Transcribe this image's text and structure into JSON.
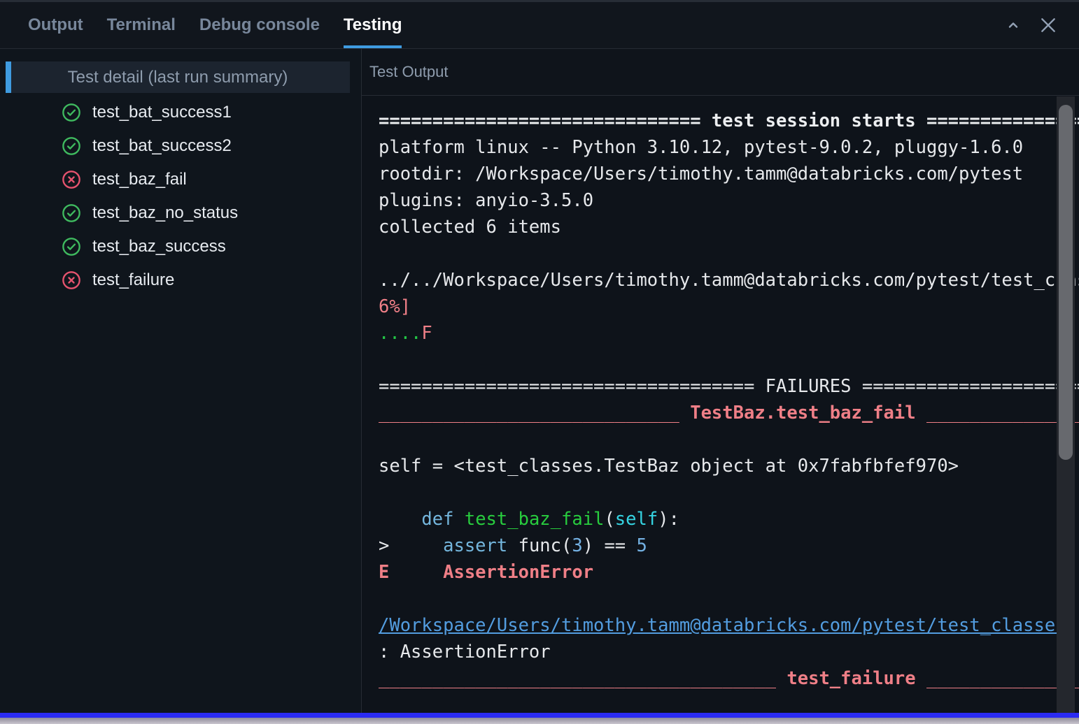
{
  "tabs": {
    "items": [
      {
        "label": "Output",
        "active": false
      },
      {
        "label": "Terminal",
        "active": false
      },
      {
        "label": "Debug console",
        "active": false
      },
      {
        "label": "Testing",
        "active": true
      }
    ]
  },
  "window_controls": {
    "collapse_icon": "chevron-up-icon",
    "close_icon": "close-icon"
  },
  "sidebar": {
    "header": "Test detail (last run summary)",
    "status_icons": {
      "pass": "check-circle-icon",
      "fail": "x-circle-icon"
    },
    "tests": [
      {
        "name": "test_bat_success1",
        "status": "pass"
      },
      {
        "name": "test_bat_success2",
        "status": "pass"
      },
      {
        "name": "test_baz_fail",
        "status": "fail"
      },
      {
        "name": "test_baz_no_status",
        "status": "pass"
      },
      {
        "name": "test_baz_success",
        "status": "pass"
      },
      {
        "name": "test_failure",
        "status": "fail"
      }
    ]
  },
  "output_panel": {
    "header": "Test Output",
    "lines": [
      [
        {
          "t": "============================== test session starts ==================================",
          "c": "wb"
        }
      ],
      [
        {
          "t": "platform linux -- Python 3.10.12, pytest-9.0.2, pluggy-1.6.0",
          "c": "w"
        }
      ],
      [
        {
          "t": "rootdir: /Workspace/Users/timothy.tamm@databricks.com/pytest",
          "c": "w"
        }
      ],
      [
        {
          "t": "plugins: anyio-3.5.0",
          "c": "w"
        }
      ],
      [
        {
          "t": "collected 6 items",
          "c": "w"
        }
      ],
      [],
      [
        {
          "t": "../../Workspace/Users/timothy.tamm@databricks.com/pytest/test_classes.py",
          "c": "w"
        }
      ],
      [
        {
          "t": "6%]",
          "c": "sal"
        }
      ],
      [
        {
          "t": "....",
          "c": "grn"
        },
        {
          "t": "F",
          "c": "sal"
        }
      ],
      [],
      [
        {
          "t": "=================================== FAILURES ===================================",
          "c": "w"
        }
      ],
      [
        {
          "t": "____________________________ ",
          "c": "sal"
        },
        {
          "t": "TestBaz.test_baz_fail",
          "c": "salb"
        },
        {
          "t": " ______________________________________",
          "c": "sal"
        }
      ],
      [],
      [
        {
          "t": "self = <test_classes.TestBaz object at 0x7fabfbfef970>",
          "c": "w"
        }
      ],
      [],
      [
        {
          "t": "    ",
          "c": "w"
        },
        {
          "t": "def",
          "c": "kw"
        },
        {
          "t": " ",
          "c": "w"
        },
        {
          "t": "test_baz_fail",
          "c": "fn"
        },
        {
          "t": "(",
          "c": "w"
        },
        {
          "t": "self",
          "c": "slf"
        },
        {
          "t": "):",
          "c": "w"
        }
      ],
      [
        {
          "t": ">     ",
          "c": "w"
        },
        {
          "t": "assert",
          "c": "kw"
        },
        {
          "t": " func(",
          "c": "w"
        },
        {
          "t": "3",
          "c": "num"
        },
        {
          "t": ") == ",
          "c": "w"
        },
        {
          "t": "5",
          "c": "num"
        }
      ],
      [
        {
          "t": "E",
          "c": "salb"
        },
        {
          "t": "     ",
          "c": "w"
        },
        {
          "t": "AssertionError",
          "c": "salb"
        }
      ],
      [],
      [
        {
          "t": "/Workspace/Users/timothy.tamm@databricks.com/pytest/test_classes",
          "c": "lnk"
        }
      ],
      [
        {
          "t": ": AssertionError",
          "c": "w"
        }
      ],
      [
        {
          "t": "_____________________________________ ",
          "c": "sal"
        },
        {
          "t": "test_failure",
          "c": "salb"
        },
        {
          "t": " ______________________________",
          "c": "sal"
        }
      ]
    ]
  },
  "colors": {
    "accent_blue": "#3f9be0",
    "pass_green": "#3fba5f",
    "fail_red": "#e5536e",
    "salmon": "#ef7f87",
    "link_blue": "#539de0",
    "bottom_bar_blue": "#2b2bf2"
  }
}
